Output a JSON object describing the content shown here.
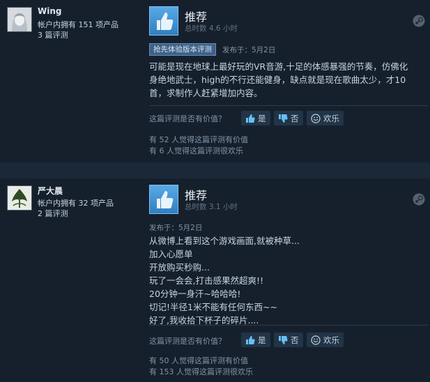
{
  "reviews": [
    {
      "username": "Wing",
      "products_owned": "帐户内拥有 151 项产品",
      "review_count": "3 篇评测",
      "verdict": "推荐",
      "hours": "总时数 4.6 小时",
      "early_access_badge": "抢先体验版本评测",
      "posted": "发布于：5月2日",
      "body": [
        "可能是现在地球上最好玩的VR音游,十足的体感暴强的节奏，仿佛化",
        "身绝地武士，high的不行还能健身，缺点就是现在歌曲太少，才10",
        "首，求制作人赶紧增加内容。"
      ],
      "helpful_question": "这篇评测是否有价值？",
      "yes_label": "是",
      "no_label": "否",
      "funny_label": "欢乐",
      "helpful_count": "有 52 人觉得这篇评测有价值",
      "funny_count": "有 6 人觉得这篇评测很欢乐"
    },
    {
      "username": "严大晨",
      "products_owned": "帐户内拥有 32 项产品",
      "review_count": "2 篇评测",
      "verdict": "推荐",
      "hours": "总时数 3.1 小时",
      "posted": "发布于：5月2日",
      "body": [
        "从微博上看到这个游戏画面,就被种草...",
        "加入心愿单",
        "开放购买秒购...",
        "玩了一会会,打击感果然超爽!!",
        "20分钟一身汗~哈哈哈!",
        "切记!半径1米不能有任何东西~~",
        "好了,我收拾下杯子的碎片...."
      ],
      "helpful_question": "这篇评测是否有价值？",
      "yes_label": "是",
      "no_label": "否",
      "funny_label": "欢乐",
      "helpful_count": "有 50 人觉得这篇评测有价值",
      "funny_count": "有 153 人觉得这篇评测很欢乐"
    }
  ]
}
